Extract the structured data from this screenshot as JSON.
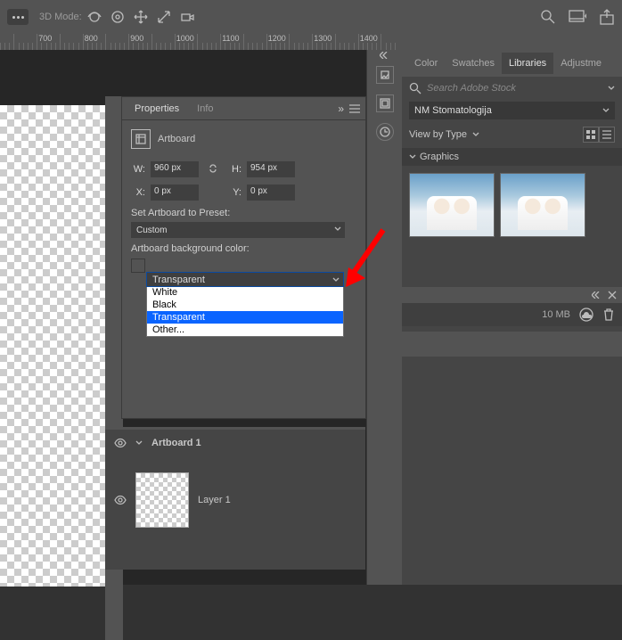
{
  "topbar": {
    "mode_label": "3D Mode:"
  },
  "ruler": {
    "ticks": [
      700,
      800,
      900,
      1000,
      1100,
      1200,
      1300,
      1400
    ]
  },
  "properties": {
    "tabs": {
      "active": "Properties",
      "inactive": "Info"
    },
    "header_label": "Artboard",
    "w_label": "W:",
    "w_value": "960 px",
    "h_label": "H:",
    "h_value": "954 px",
    "x_label": "X:",
    "x_value": "0 px",
    "y_label": "Y:",
    "y_value": "0 px",
    "preset_label": "Set Artboard to Preset:",
    "preset_value": "Custom",
    "bg_label": "Artboard background color:",
    "bg_selected": "Transparent",
    "bg_options": [
      "White",
      "Black",
      "Transparent",
      "Other..."
    ],
    "bg_highlight_index": 2
  },
  "layers": {
    "artboard": "Artboard 1",
    "layer": "Layer 1"
  },
  "right": {
    "tabs": [
      "Color",
      "Swatches",
      "Libraries",
      "Adjustme"
    ],
    "active_tab_index": 2,
    "search_placeholder": "Search Adobe Stock",
    "library_name": "NM Stomatologija",
    "viewby_label": "View by Type",
    "section": "Graphics",
    "status_size": "10 MB"
  }
}
